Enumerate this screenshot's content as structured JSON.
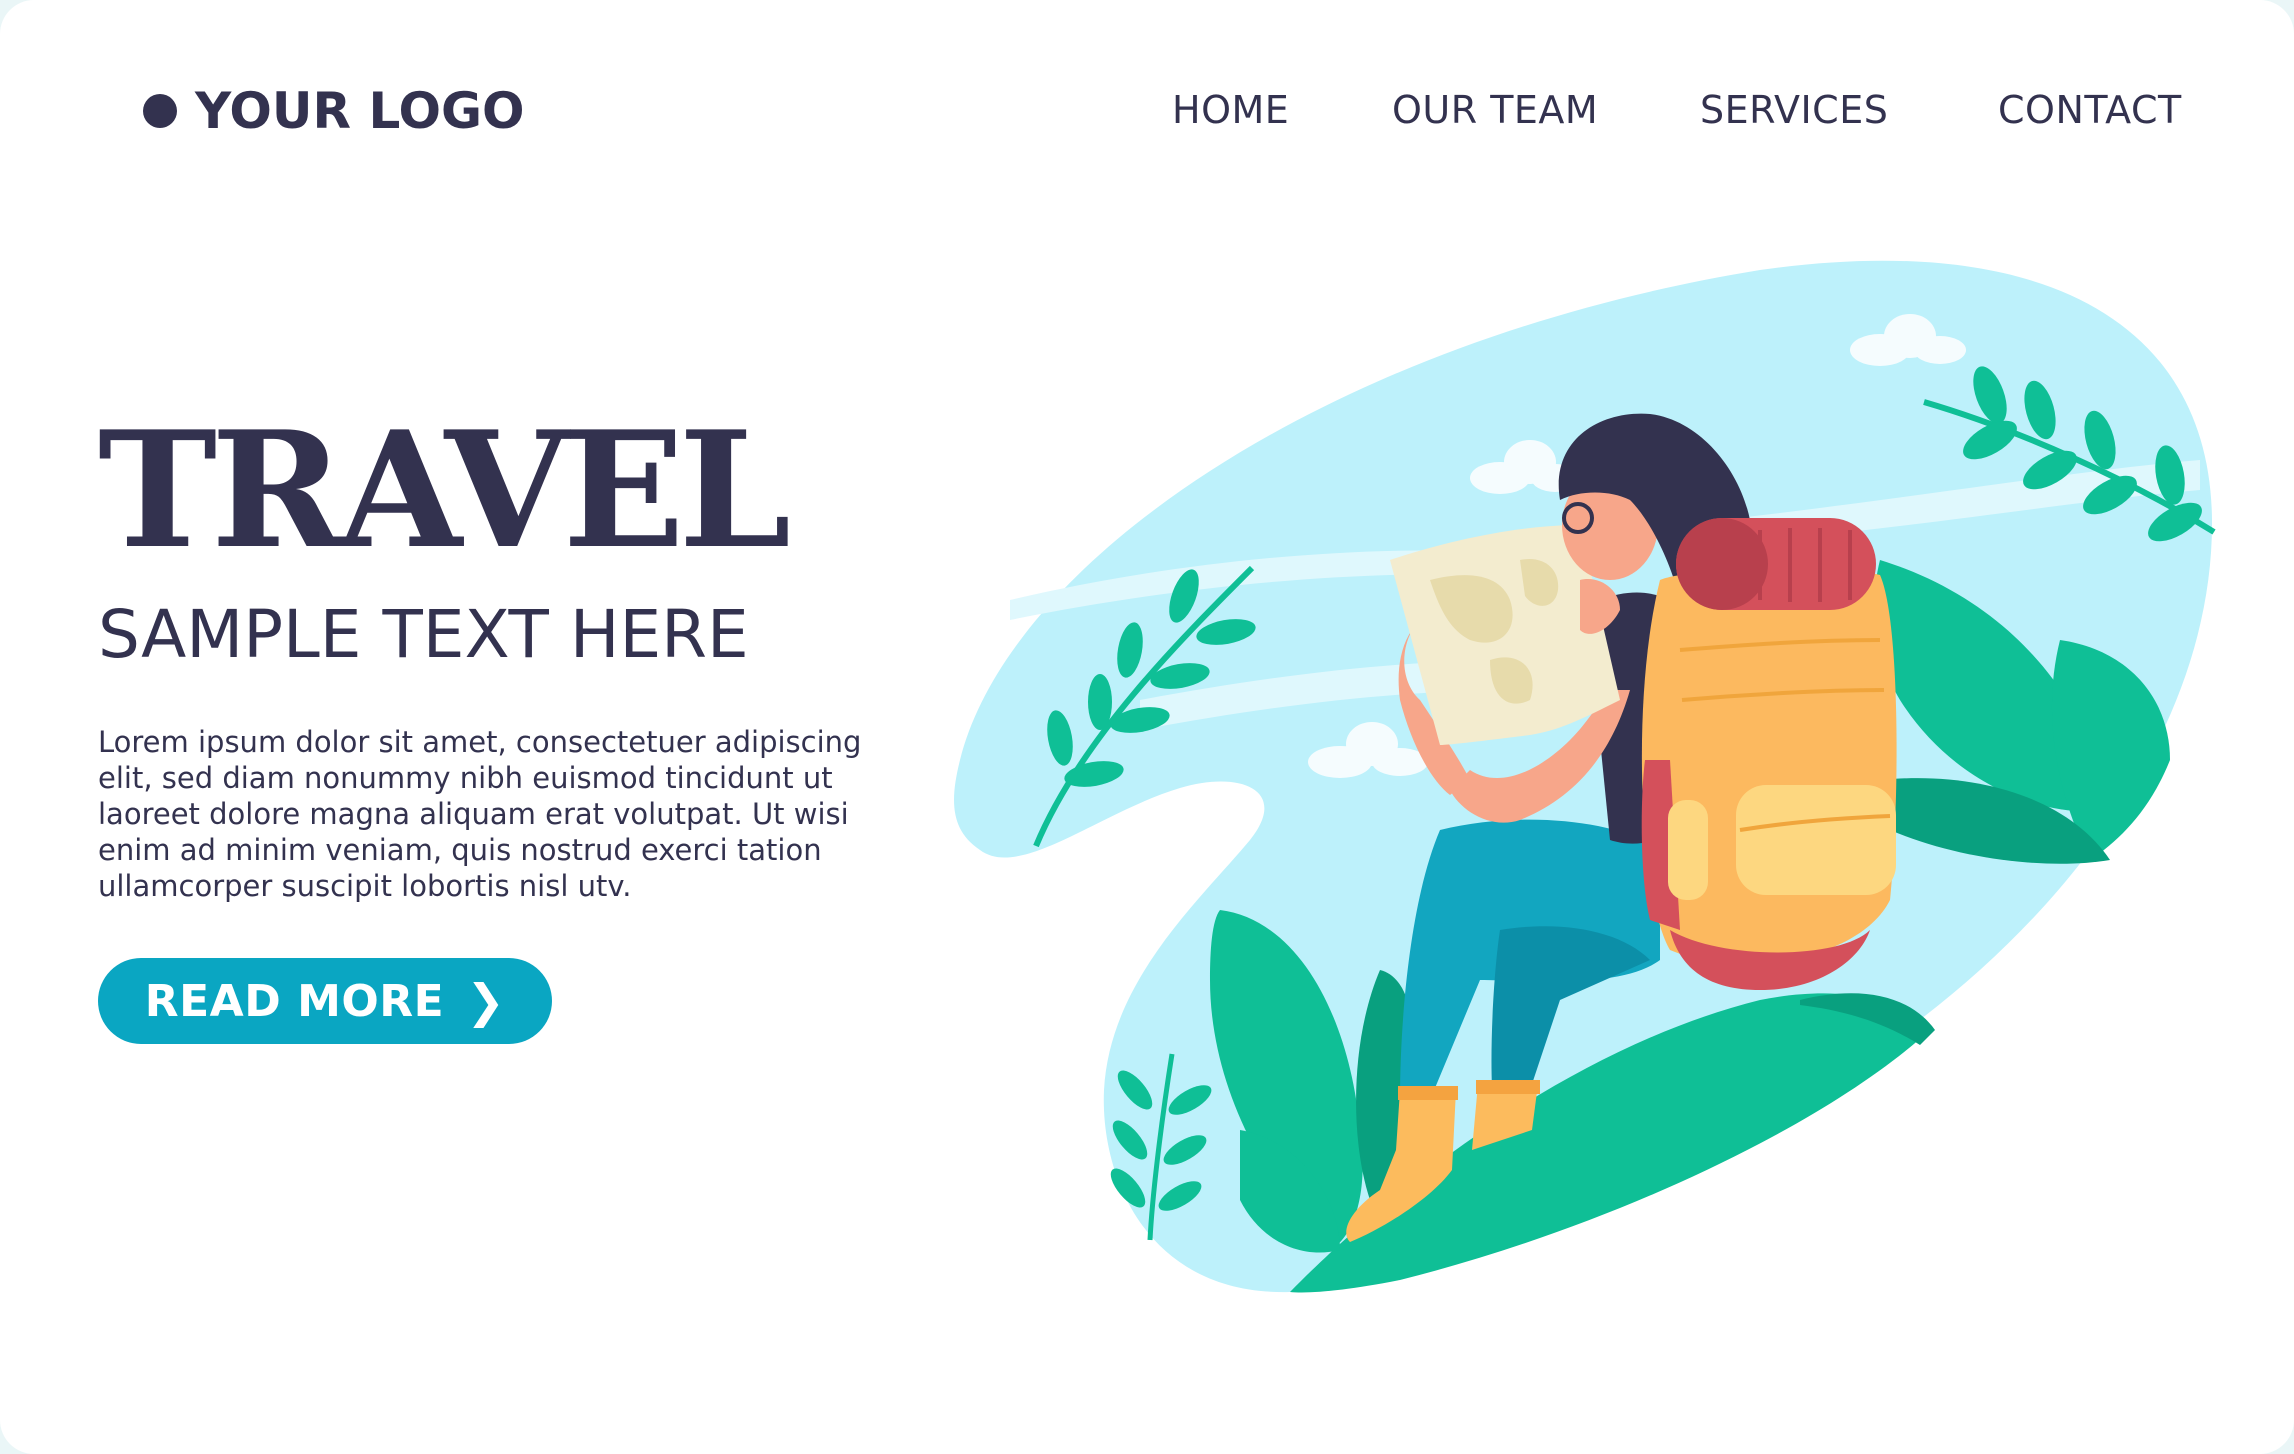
{
  "brand": {
    "logo_text": "YOUR LOGO"
  },
  "nav": {
    "items": [
      {
        "label": "HOME"
      },
      {
        "label": "OUR TEAM"
      },
      {
        "label": "SERVICES"
      },
      {
        "label": "CONTACT"
      }
    ]
  },
  "hero": {
    "title": "TRAVEL",
    "subtitle": "SAMPLE TEXT HERE",
    "body": "Lorem ipsum dolor sit amet, consectetuer adipiscing elit, sed diam nonummy nibh euismod tincidunt ut laoreet dolore magna aliquam erat volutpat. Ut wisi enim ad minim veniam, quis nostrud exerci tation ullamcorper suscipit lobortis nisl utv.",
    "cta_label": "READ MORE",
    "cta_icon": "chevron-right-icon"
  },
  "colors": {
    "text": "#33324f",
    "accent": "#0aa6c2",
    "sky": "#bdf1fb",
    "leaf": "#0fbf96",
    "leaf_dark": "#09a07f",
    "backpack": "#fcb95f",
    "bedroll": "#d4505b",
    "jeans": "#12a6c0",
    "map": "#f3eccf"
  },
  "illustration": {
    "name": "hiker-with-map",
    "icons": [
      "cloud-icon",
      "leaf-branch-icon",
      "backpack-icon",
      "map-icon"
    ]
  }
}
